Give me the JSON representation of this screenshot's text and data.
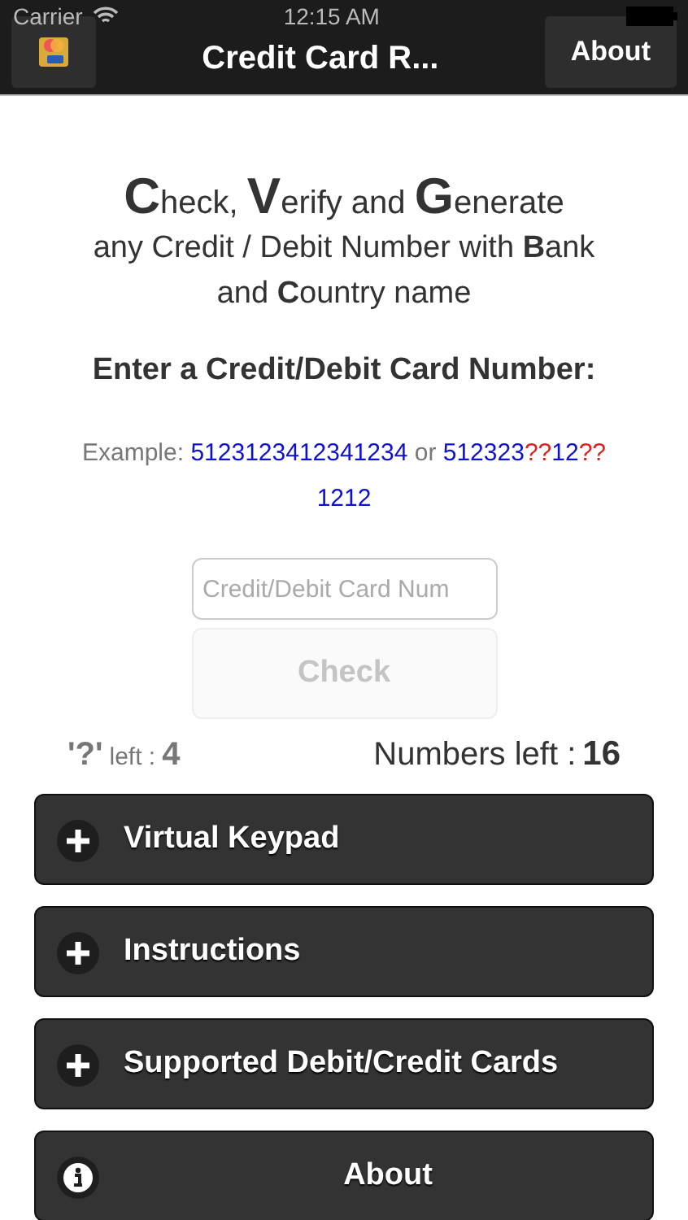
{
  "status_bar": {
    "carrier": "Carrier",
    "time": "12:15 AM"
  },
  "nav_bar": {
    "title": "Credit Card R...",
    "right_button": "About"
  },
  "headline": [
    "**C**heck, **V**erify and **G**enerate",
    "any Credit / Debit Number with **B**ank",
    "and **C**ountry name"
  ],
  "prompt": "Enter a Credit/Debit Card Number:",
  "example": {
    "lines": [
      [
        {
          "kind": "label",
          "text": "Example: "
        },
        {
          "kind": "number",
          "text": "5123123412341234"
        },
        {
          "kind": "label",
          "text": " or "
        },
        {
          "kind": "number",
          "text": "512323"
        },
        {
          "kind": "wild",
          "text": "??"
        },
        {
          "kind": "number",
          "text": "12"
        },
        {
          "kind": "wild",
          "text": "??"
        }
      ],
      [
        {
          "kind": "number",
          "text": "1212"
        }
      ]
    ]
  },
  "card_field": {
    "placeholder": "Credit/Debit Card Num"
  },
  "check_button": {
    "label": "Check",
    "disabled": true
  },
  "counters": {
    "wild_symbol": "'?'",
    "wild_label": "left :",
    "wild_value": "4",
    "numbers_label": "Numbers left :",
    "numbers_value": "16"
  },
  "sections": [
    {
      "kind": "plus",
      "label": "Virtual Keypad"
    },
    {
      "kind": "plus",
      "label": "Instructions"
    },
    {
      "kind": "plus",
      "label": "Supported Debit/Credit Cards"
    },
    {
      "kind": "info",
      "label": "About"
    }
  ]
}
